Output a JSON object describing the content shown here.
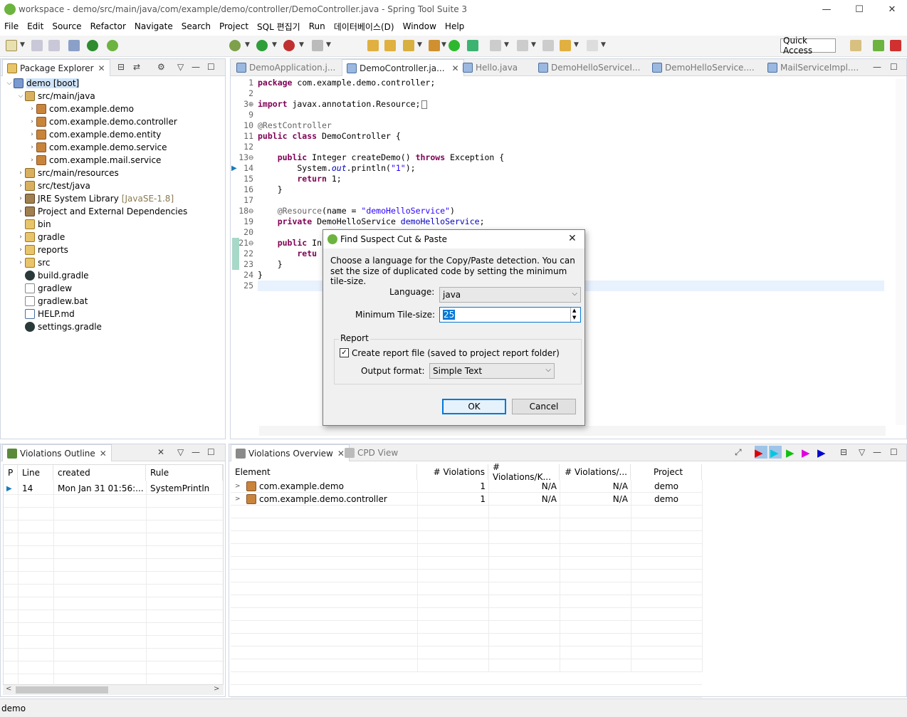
{
  "window": {
    "title": "workspace - demo/src/main/java/com/example/demo/controller/DemoController.java - Spring Tool Suite 3"
  },
  "menu": [
    "File",
    "Edit",
    "Source",
    "Refactor",
    "Navigate",
    "Search",
    "Project",
    "SQL 편집기",
    "Run",
    "데이터베이스(D)",
    "Window",
    "Help"
  ],
  "toolbar": {
    "quick_access": "Quick Access"
  },
  "package_explorer": {
    "tab_label": "Package Explorer",
    "items": [
      {
        "label": "demo [boot]",
        "depth": 0,
        "arrow": "v",
        "icon": "project-icon",
        "selected": true
      },
      {
        "label": "src/main/java",
        "depth": 1,
        "arrow": "v",
        "icon": "source-folder-icon"
      },
      {
        "label": "com.example.demo",
        "depth": 2,
        "arrow": ">",
        "icon": "package-icon"
      },
      {
        "label": "com.example.demo.controller",
        "depth": 2,
        "arrow": ">",
        "icon": "package-icon"
      },
      {
        "label": "com.example.demo.entity",
        "depth": 2,
        "arrow": ">",
        "icon": "package-icon"
      },
      {
        "label": "com.example.demo.service",
        "depth": 2,
        "arrow": ">",
        "icon": "package-icon"
      },
      {
        "label": "com.example.mail.service",
        "depth": 2,
        "arrow": ">",
        "icon": "package-icon"
      },
      {
        "label": "src/main/resources",
        "depth": 1,
        "arrow": ">",
        "icon": "source-folder-icon"
      },
      {
        "label": "src/test/java",
        "depth": 1,
        "arrow": ">",
        "icon": "source-folder-icon"
      },
      {
        "label": "JRE System Library",
        "extra": "[JavaSE-1.8]",
        "depth": 1,
        "arrow": ">",
        "icon": "library-icon"
      },
      {
        "label": "Project and External Dependencies",
        "depth": 1,
        "arrow": ">",
        "icon": "library-icon"
      },
      {
        "label": "bin",
        "depth": 1,
        "arrow": "",
        "icon": "folder-icon"
      },
      {
        "label": "gradle",
        "depth": 1,
        "arrow": ">",
        "icon": "folder-icon"
      },
      {
        "label": "reports",
        "depth": 1,
        "arrow": ">",
        "icon": "folder-icon"
      },
      {
        "label": "src",
        "depth": 1,
        "arrow": ">",
        "icon": "folder-icon"
      },
      {
        "label": "build.gradle",
        "depth": 1,
        "arrow": "",
        "icon": "gradle-icon"
      },
      {
        "label": "gradlew",
        "depth": 1,
        "arrow": "",
        "icon": "file-icon"
      },
      {
        "label": "gradlew.bat",
        "depth": 1,
        "arrow": "",
        "icon": "file-icon"
      },
      {
        "label": "HELP.md",
        "depth": 1,
        "arrow": "",
        "icon": "markdown-icon"
      },
      {
        "label": "settings.gradle",
        "depth": 1,
        "arrow": "",
        "icon": "gradle-icon"
      }
    ]
  },
  "editor": {
    "tabs": [
      {
        "label": "DemoApplication.j...",
        "active": false
      },
      {
        "label": "DemoController.ja...",
        "active": true
      },
      {
        "label": "Hello.java",
        "active": false
      },
      {
        "label": "DemoHelloServiceI...",
        "active": false
      },
      {
        "label": "DemoHelloService....",
        "active": false
      },
      {
        "label": "MailServiceImpl....",
        "active": false
      }
    ],
    "line_numbers": [
      "1",
      "2",
      "3⊕",
      "9",
      "10",
      "11",
      "12",
      "13⊖",
      "14",
      "15",
      "16",
      "17",
      "18⊖",
      "19",
      "20",
      "21⊖",
      "22",
      "23",
      "24",
      "25"
    ],
    "code": {
      "l1a": "package",
      "l1b": " com.example.demo.controller;",
      "l3a": "import",
      "l3b": " javax.annotation.Resource;",
      "l10": "@RestController",
      "l11a": "public class",
      "l11b": " DemoController {",
      "l13a": "    public",
      "l13b": " Integer createDemo() ",
      "l13c": "throws",
      "l13d": " Exception {",
      "l14a": "        System.",
      "l14b": "out",
      "l14c": ".println(",
      "l14d": "\"1\"",
      "l14e": ");",
      "l15a": "        return",
      "l15b": " 1;",
      "l16": "    }",
      "l18a": "    @Resource",
      "l18b": "(name = ",
      "l18c": "\"demoHelloService\"",
      "l18d": ")",
      "l19a": "    private",
      "l19b": " DemoHelloService ",
      "l19c": "demoHelloService",
      "l19d": ";",
      "l21a": "    public",
      "l21b": " In",
      "l22a": "        retu",
      "l23": "    }",
      "l24": "}"
    }
  },
  "dialog": {
    "title": "Find Suspect Cut & Paste",
    "description_1": "Choose a language for the Copy/Paste detection. You can",
    "description_2": "set the size of duplicated code by setting the minimum tile-size.",
    "language_label": "Language:",
    "language_value": "java",
    "tile_label": "Minimum Tile-size:",
    "tile_value": "25",
    "report_group": "Report",
    "create_report_label": "Create report file (saved to project report folder)",
    "output_format_label": "Output format:",
    "output_format_value": "Simple Text",
    "ok": "OK",
    "cancel": "Cancel"
  },
  "violations_outline": {
    "tab_label": "Violations Outline",
    "columns": [
      "P",
      "Line",
      "created",
      "Rule"
    ],
    "rows": [
      {
        "line": "14",
        "created": "Mon Jan 31 01:56:...",
        "rule": "SystemPrintln"
      }
    ]
  },
  "violations_overview": {
    "tab_label": "Violations Overview",
    "cpd_tab": "CPD View",
    "columns": [
      "Element",
      "# Violations",
      "# Violations/K...",
      "# Violations/...",
      "Project"
    ],
    "rows": [
      {
        "element": "com.example.demo",
        "violations": "1",
        "per_kloc": "N/A",
        "per_method": "N/A",
        "project": "demo"
      },
      {
        "element": "com.example.demo.controller",
        "violations": "1",
        "per_kloc": "N/A",
        "per_method": "N/A",
        "project": "demo"
      }
    ]
  },
  "status": {
    "text": "demo"
  },
  "colors": {
    "accent": "#0078d7",
    "selection": "#cfe4f8",
    "keyword": "#7f0055",
    "string": "#2a00ff"
  }
}
